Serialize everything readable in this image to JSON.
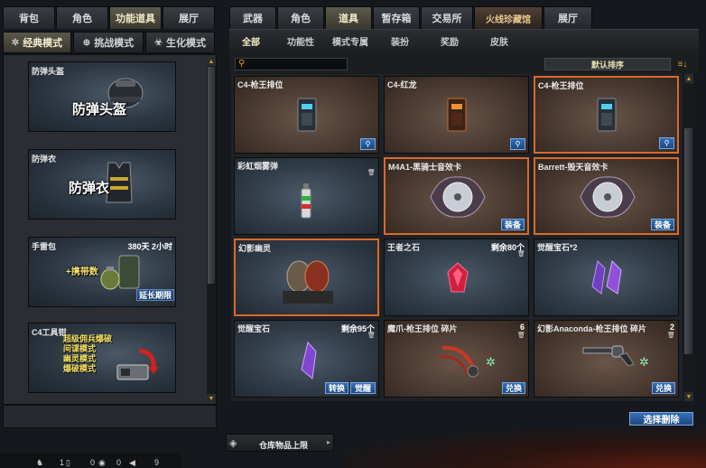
{
  "left_tabs": [
    "背包",
    "角色",
    "功能道具",
    "展厅"
  ],
  "right_tabs": [
    "武器",
    "角色",
    "道具",
    "暂存箱",
    "交易所",
    "火线珍藏馆",
    "展厅"
  ],
  "mode_tabs": [
    "经典模式",
    "挑战模式",
    "生化模式"
  ],
  "sub_tabs": [
    "全部",
    "功能性",
    "模式专属",
    "装扮",
    "奖励",
    "皮肤"
  ],
  "search": {
    "placeholder": ""
  },
  "sort": {
    "label": "默认排序"
  },
  "left_items": [
    {
      "name": "防弹头盔",
      "big": "防弹头盔"
    },
    {
      "name": "防弹衣",
      "big": "防弹衣"
    },
    {
      "name": "手雷包",
      "time": "380天 2小时",
      "big": "+携带数",
      "button": "延长期限"
    },
    {
      "name": "C4工具钳",
      "lines": [
        "超级佣兵爆破",
        "间谍模式",
        "幽灵模式",
        "爆破模式"
      ]
    }
  ],
  "grid_items": [
    {
      "name": "C4-枪王排位",
      "icon": "c4-icon",
      "action": "magnify"
    },
    {
      "name": "C4-红龙",
      "icon": "c4-red-icon",
      "action": "magnify"
    },
    {
      "name": "C4-枪王排位",
      "icon": "c4-icon",
      "action": "magnify"
    },
    {
      "name": "彩虹烟雾弹",
      "icon": "smoke-grenade-icon"
    },
    {
      "name": "M4A1-黑骑士音效卡",
      "icon": "sound-card-icon",
      "button": "装备"
    },
    {
      "name": "Barrett-毁天音效卡",
      "icon": "sound-card-icon",
      "button": "装备"
    },
    {
      "name": "幻影幽灵",
      "icon": "ghost-masks-icon"
    },
    {
      "name": "王者之石",
      "count": "剩余80个",
      "icon": "red-gem-icon"
    },
    {
      "name": "觉醒宝石*2",
      "icon": "purple-gems-icon"
    },
    {
      "name": "觉醒宝石",
      "count": "剩余95个",
      "icon": "purple-gem-icon",
      "buttons": [
        "转换",
        "觉醒"
      ]
    },
    {
      "name": "魔爪-枪王排位 碎片",
      "count": "6",
      "icon": "claw-icon",
      "button": "兑换"
    },
    {
      "name": "幻影Anaconda-枪王排位 碎片",
      "count": "2",
      "icon": "revolver-icon",
      "button": "兑换"
    }
  ],
  "select_delete_label": "选择删除",
  "storage_label": "仓库物品上限",
  "status_bar": {
    "count1": "1",
    "count2": "0",
    "count3": "0",
    "count4": "9"
  }
}
